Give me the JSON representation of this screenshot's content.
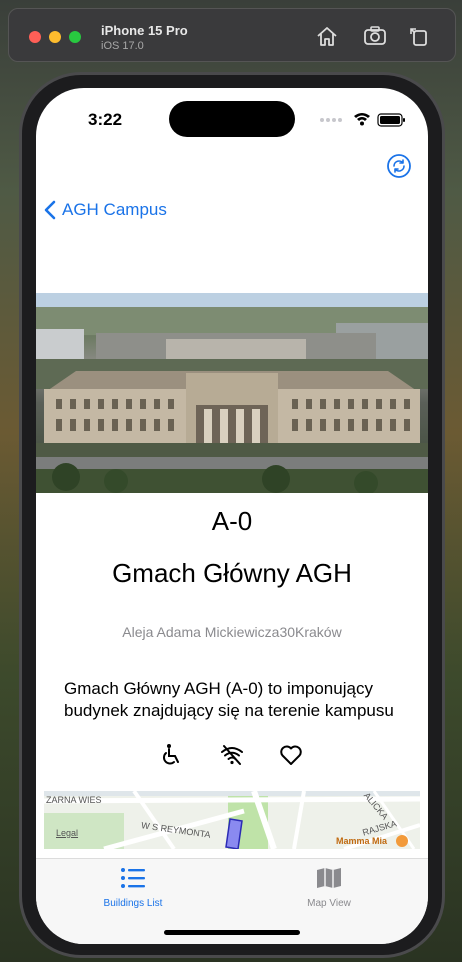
{
  "simulator": {
    "device_name": "iPhone 15 Pro",
    "os_version": "iOS 17.0",
    "toolbar_icons": [
      "home-icon",
      "screenshot-icon",
      "rotate-icon"
    ]
  },
  "status_bar": {
    "time": "3:22",
    "icons": [
      "cellular-dots-icon",
      "wifi-icon",
      "battery-icon"
    ]
  },
  "nav": {
    "back_label": "AGH Campus",
    "refresh_icon": "refresh-icon"
  },
  "building": {
    "id": "A-0",
    "name": "Gmach Główny AGH",
    "address": "Aleja Adama Mickiewicza30Kraków",
    "description": "Gmach Główny AGH (A-0) to imponujący budynek znajdujący się na terenie kampusu",
    "feature_icons": [
      "wheelchair-accessible-icon",
      "no-wifi-icon",
      "favorite-heart-icon"
    ]
  },
  "map": {
    "labels": [
      "ZARNA WIES",
      "Legal",
      "W S REYMONTA",
      "RAJSKA",
      "ALICKA",
      "Mamma Mia"
    ]
  },
  "tabs": [
    {
      "label": "Buildings List",
      "icon": "list-icon",
      "active": true
    },
    {
      "label": "Map View",
      "icon": "map-icon",
      "active": false
    }
  ],
  "colors": {
    "accent": "#1a73e8",
    "inactive_tab": "#8a8a8e",
    "address_text": "#8a8a8e"
  }
}
